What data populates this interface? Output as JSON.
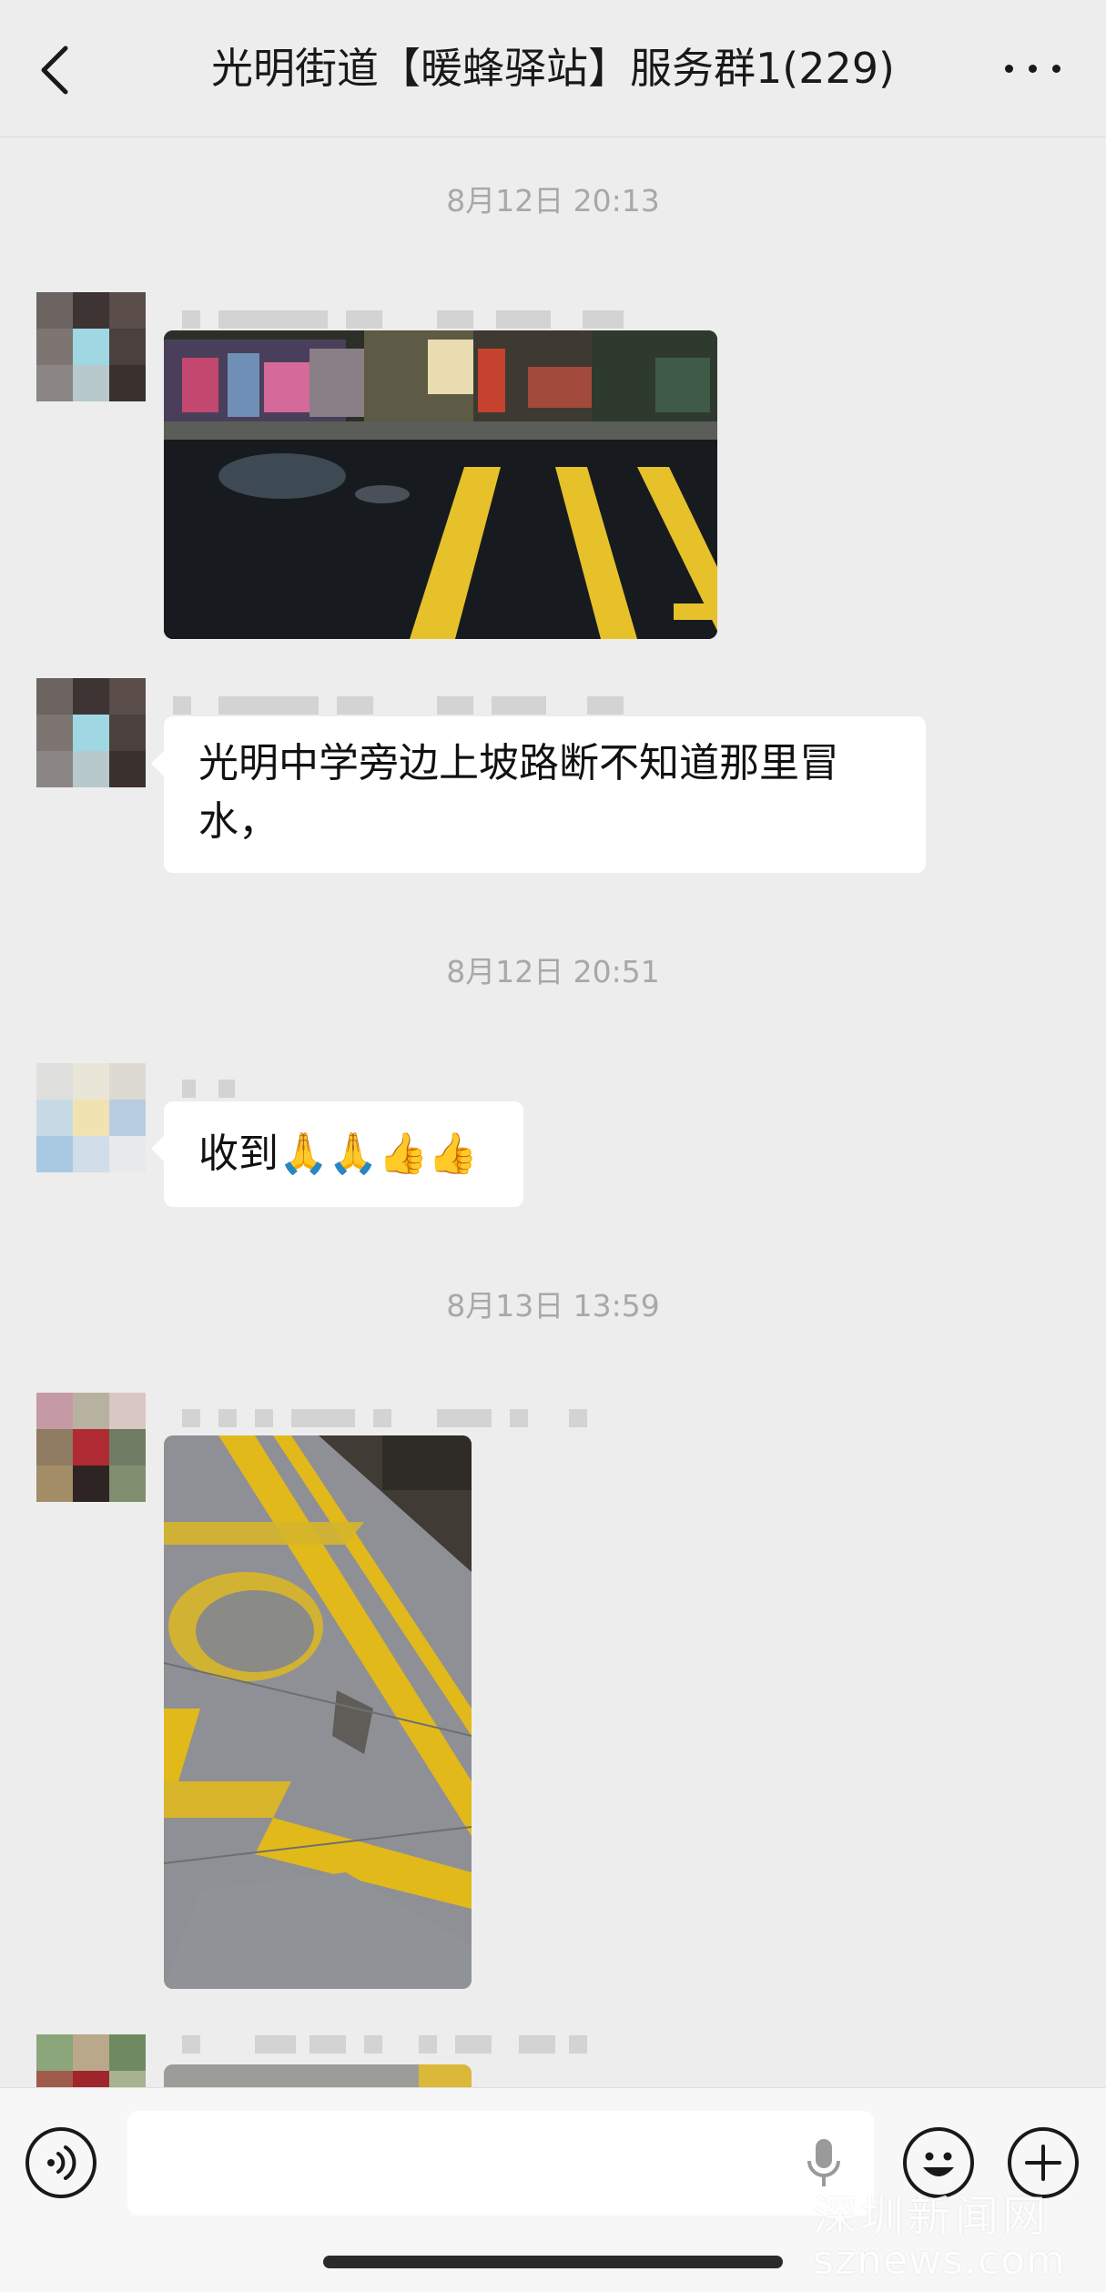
{
  "header": {
    "title": "光明街道【暖蜂驿站】服务群1(229)"
  },
  "timestamps": {
    "t1": "8月12日 20:13",
    "t2": "8月12日 20:51",
    "t3": "8月13日 13:59"
  },
  "messages": {
    "text1": "光明中学旁边上坡路断不知道那里冒水，",
    "text2": "收到🙏🙏👍👍"
  },
  "input": {
    "value": ""
  },
  "watermark": {
    "cn": "深圳新闻网",
    "en": "sznews.com"
  },
  "colors": {
    "background": "#ededed",
    "bubble": "#ffffff",
    "timestamp": "#a8a8a8"
  }
}
